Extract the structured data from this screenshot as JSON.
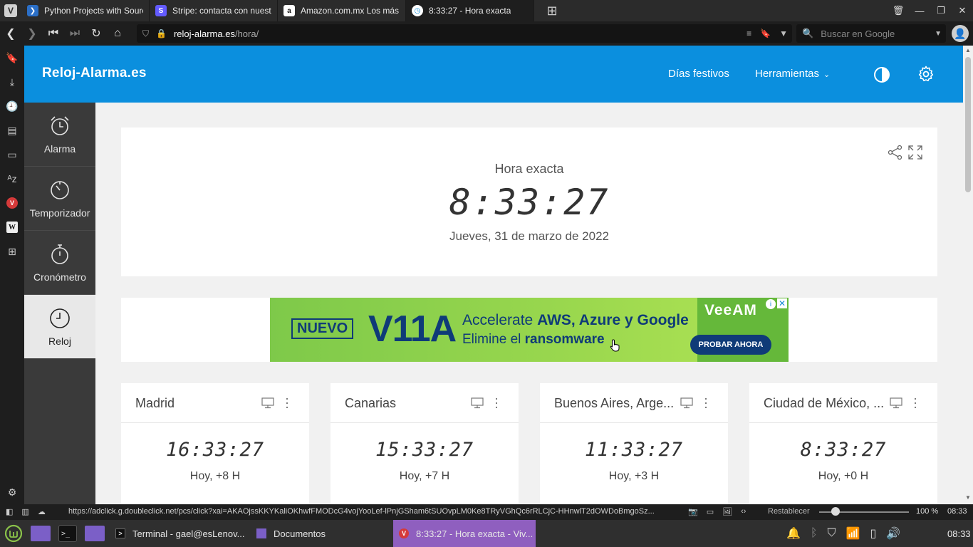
{
  "browser": {
    "tabs": [
      {
        "title": "Python Projects with Sourc",
        "favicon": "python-icon",
        "color": "#2b6fc7",
        "letter": "",
        "active": false
      },
      {
        "title": "Stripe: contacta con nuestr",
        "favicon": "stripe-icon",
        "color": "#635bff",
        "letter": "S",
        "active": false
      },
      {
        "title": "Amazon.com.mx Los más v",
        "favicon": "amazon-icon",
        "color": "#ffffff",
        "letter": "a",
        "active": false
      },
      {
        "title": "8:33:27 - Hora exacta",
        "favicon": "clock-icon",
        "color": "#ffffff",
        "letter": "",
        "active": true
      }
    ],
    "url_host": "reloj-alarma.es",
    "url_path": "/hora/",
    "search_placeholder": "Buscar en Google",
    "status_url": "https://adclick.g.doubleclick.net/pcs/click?xai=AKAOjssKKYKaliOKhwfFMODcG4vojYooLef-lPnjGSham6tSUOvpLM0Ke8TRyVGhQc6rRLCjC-HHnwlT2dOWDoBmgoSz...",
    "reset_label": "Restablecer",
    "zoom_label": "100 %",
    "zoom_fraction": 0.18,
    "status_time": "08:33"
  },
  "site": {
    "logo": "Reloj-Alarma.es",
    "nav": {
      "holidays": "Días festivos",
      "tools": "Herramientas"
    },
    "sidebar": [
      {
        "label": "Alarma",
        "icon": "alarm-clock-icon",
        "active": false
      },
      {
        "label": "Temporizador",
        "icon": "timer-icon",
        "active": false
      },
      {
        "label": "Cronómetro",
        "icon": "stopwatch-icon",
        "active": false
      },
      {
        "label": "Reloj",
        "icon": "clock-icon",
        "active": true
      }
    ],
    "main": {
      "title": "Hora exacta",
      "time": "8:33:27",
      "date": "Jueves, 31 de marzo de 2022"
    },
    "ad": {
      "badge": "NUEVO",
      "model": "V11A",
      "line1_prefix": "Accelerate ",
      "line1_bold": "AWS, Azure y Google",
      "line2_prefix": "Elimine el ",
      "line2_bold": "ransomware",
      "brand": "VeeAM",
      "cta": "PROBAR AHORA"
    },
    "cities": [
      {
        "name": "Madrid",
        "time": "16:33:27",
        "offset": "Hoy, +8 H"
      },
      {
        "name": "Canarias",
        "time": "15:33:27",
        "offset": "Hoy, +7 H"
      },
      {
        "name": "Buenos Aires, Arge...",
        "time": "11:33:27",
        "offset": "Hoy, +3 H"
      },
      {
        "name": "Ciudad de México, ...",
        "time": "8:33:27",
        "offset": "Hoy, +0 H"
      }
    ]
  },
  "taskbar": {
    "tasks": [
      {
        "label": "Terminal - gael@esLenov...",
        "icon": "terminal-icon",
        "active": false
      },
      {
        "label": "Documentos",
        "icon": "folder-icon",
        "active": false
      },
      {
        "label": "8:33:27 - Hora exacta - Viv...",
        "icon": "vivaldi-icon",
        "active": true
      }
    ],
    "clock": "08:33"
  },
  "colors": {
    "accent": "#0b8fde",
    "sidebar": "#3a3a3a",
    "ad_green": "#9bd84e",
    "ad_blue": "#0f3b78",
    "task_active": "#8f5fbf"
  }
}
